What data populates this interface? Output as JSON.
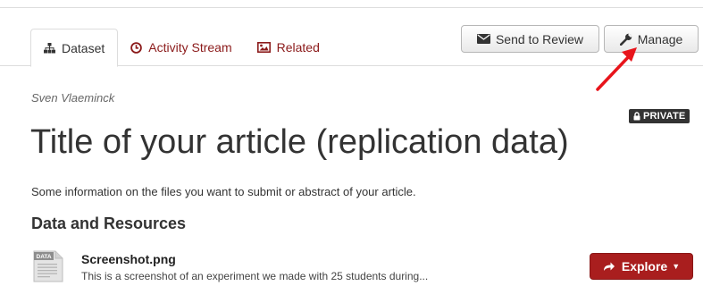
{
  "tabs": [
    {
      "label": "Dataset",
      "icon": "sitemap-icon",
      "active": true
    },
    {
      "label": "Activity Stream",
      "icon": "clock-icon",
      "active": false
    },
    {
      "label": "Related",
      "icon": "picture-icon",
      "active": false
    }
  ],
  "actions": {
    "send_review_label": "Send to Review",
    "manage_label": "Manage"
  },
  "dataset": {
    "author": "Sven Vlaeminck",
    "visibility_badge": "PRIVATE",
    "title": "Title of your article (replication data)",
    "description": "Some information on the files you want to submit or abstract of your article."
  },
  "resources": {
    "heading": "Data and Resources",
    "items": [
      {
        "format_label": "DATA",
        "name": "Screenshot.png",
        "description": "This is a screenshot of an experiment we made with 25 students during...",
        "explore_label": "Explore"
      }
    ]
  },
  "colors": {
    "accent": "#a91e1e",
    "tab_link": "#8b1a1a",
    "arrow": "#e8141b",
    "badge_bg": "#333333"
  }
}
